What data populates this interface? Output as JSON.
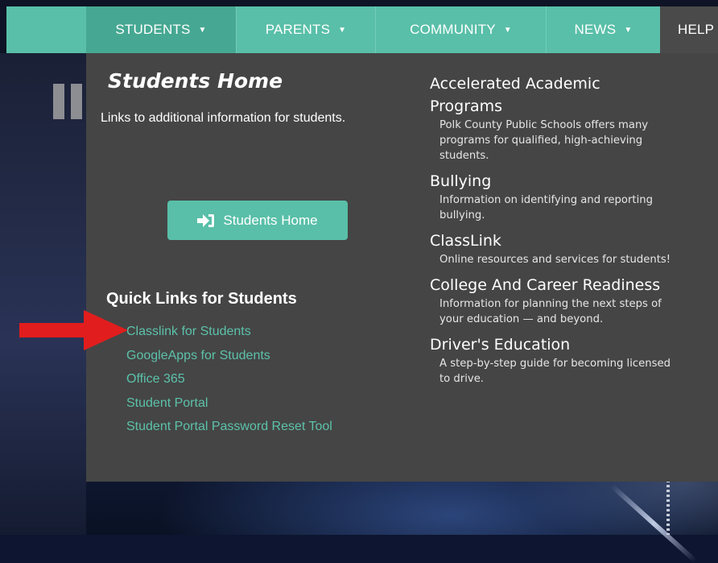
{
  "nav": {
    "items": [
      {
        "label": "STUDENTS",
        "caret": "▼"
      },
      {
        "label": "PARENTS",
        "caret": "▼"
      },
      {
        "label": "COMMUNITY",
        "caret": "▼"
      },
      {
        "label": "NEWS",
        "caret": "▼"
      },
      {
        "label": "HELP",
        "caret": ""
      }
    ],
    "active": "STUDENTS"
  },
  "dropdown": {
    "heading": "Students Home",
    "description": "Links to additional information for students.",
    "button_label": "Students Home",
    "button_icon": "sign-in-icon",
    "quick_links_heading": "Quick Links for Students",
    "quick_links": [
      "Classlink for Students",
      "GoogleApps for Students",
      "Office 365",
      "Student Portal",
      "Student Portal Password Reset Tool"
    ],
    "topics": [
      {
        "title": "Accelerated Academic Programs",
        "desc": "Polk County Public Schools offers many programs for qualified, high-achieving students."
      },
      {
        "title": "Bullying",
        "desc": "Information on identifying and reporting bullying."
      },
      {
        "title": "ClassLink",
        "desc": "Online resources and services for students!"
      },
      {
        "title": "College And Career Readiness",
        "desc": "Information for planning the next steps of your education — and beyond."
      },
      {
        "title": "Driver's Education",
        "desc": "A step-by-step guide for becoming licensed to drive."
      }
    ]
  },
  "annotation": {
    "arrow_color": "#e21d1d",
    "icon": "red-arrow-icon"
  },
  "colors": {
    "accent": "#59bfa8",
    "accent_active": "#46a892",
    "panel": "#454545",
    "link": "#5cc2aa"
  }
}
